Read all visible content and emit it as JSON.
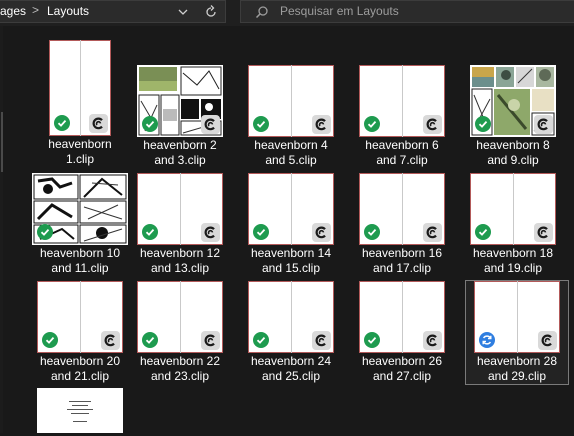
{
  "breadcrumb": {
    "previous": "ages",
    "separator": ">",
    "current": "Layouts"
  },
  "search": {
    "placeholder": "Pesquisar em Layouts"
  },
  "icons": {
    "dropdown": "chevron-down-icon",
    "refresh": "refresh-icon",
    "search": "search-icon",
    "status_ok": "check-circle-icon",
    "status_sync": "sync-icon",
    "app": "clip-studio-icon"
  },
  "colors": {
    "status_ok": "#1e9b4f",
    "status_sync": "#2f7ee0",
    "background": "#191919"
  },
  "files": [
    {
      "line1": "heavenborn",
      "line2": "1.clip",
      "status": "ok"
    },
    {
      "line1": "heavenborn 2",
      "line2": "and 3.clip",
      "status": "ok"
    },
    {
      "line1": "heavenborn 4",
      "line2": "and 5.clip",
      "status": "ok"
    },
    {
      "line1": "heavenborn 6",
      "line2": "and 7.clip",
      "status": "ok"
    },
    {
      "line1": "heavenborn 8",
      "line2": "and 9.clip",
      "status": "ok"
    },
    {
      "line1": "heavenborn 10",
      "line2": "and 11.clip",
      "status": "ok"
    },
    {
      "line1": "heavenborn 12",
      "line2": "and 13.clip",
      "status": "ok"
    },
    {
      "line1": "heavenborn 14",
      "line2": "and 15.clip",
      "status": "ok"
    },
    {
      "line1": "heavenborn 16",
      "line2": "and 17.clip",
      "status": "ok"
    },
    {
      "line1": "heavenborn 18",
      "line2": "and 19.clip",
      "status": "ok"
    },
    {
      "line1": "heavenborn 20",
      "line2": "and 21.clip",
      "status": "ok"
    },
    {
      "line1": "heavenborn 22",
      "line2": "and 23.clip",
      "status": "ok"
    },
    {
      "line1": "heavenborn 24",
      "line2": "and 25.clip",
      "status": "ok"
    },
    {
      "line1": "heavenborn 26",
      "line2": "and 27.clip",
      "status": "ok"
    },
    {
      "line1": "heavenborn 28",
      "line2": "and 29.clip",
      "status": "sync"
    }
  ]
}
